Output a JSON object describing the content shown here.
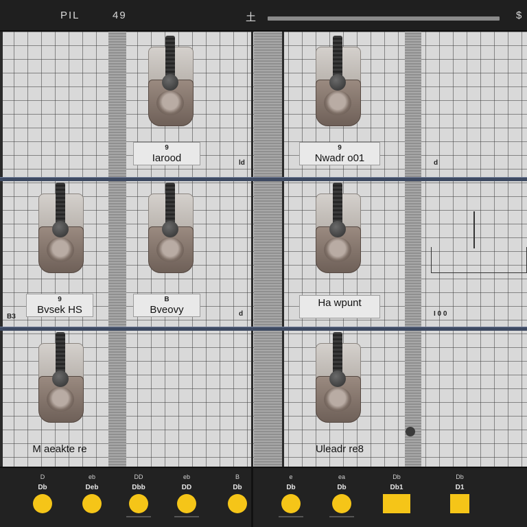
{
  "header": {
    "title_left": "PIL",
    "value_left": "49",
    "icon_mid": "土",
    "icon_right": "$"
  },
  "cells": [
    {
      "number": "9",
      "name": "Iarood",
      "corner": "ld"
    },
    {
      "number": "9",
      "name": "Nwadr o01",
      "corner": "d"
    },
    {
      "number": "9",
      "name": "Bvsek HS",
      "corner": "B3"
    },
    {
      "number": "B",
      "name": "Bveovy",
      "corner": "d"
    },
    {
      "number": "",
      "name": "Ha wpunt",
      "corner": "I 0 0"
    },
    {
      "number": "",
      "name": "M aeakte re",
      "corner": ""
    },
    {
      "number": "",
      "name": "Uleadr re8",
      "corner": ""
    }
  ],
  "controls": [
    {
      "label": "D",
      "value": "Db",
      "kind": "dot"
    },
    {
      "label": "eb",
      "value": "Deb",
      "kind": "dot"
    },
    {
      "label": "DD",
      "value": "Dbb",
      "kind": "dot"
    },
    {
      "label": "eb",
      "value": "DD",
      "kind": "dot"
    },
    {
      "label": "B",
      "value": "Db",
      "kind": "dot"
    },
    {
      "label": "e",
      "value": "Db",
      "kind": "dot"
    },
    {
      "label": "ea",
      "value": "Db",
      "kind": "dot"
    },
    {
      "label": "Db",
      "value": "Db1",
      "kind": "square"
    },
    {
      "label": "Db",
      "value": "D1",
      "kind": "square-small"
    }
  ],
  "colors": {
    "accent": "#f5c518",
    "divider": "#3e4a62",
    "panel": "#222222"
  }
}
